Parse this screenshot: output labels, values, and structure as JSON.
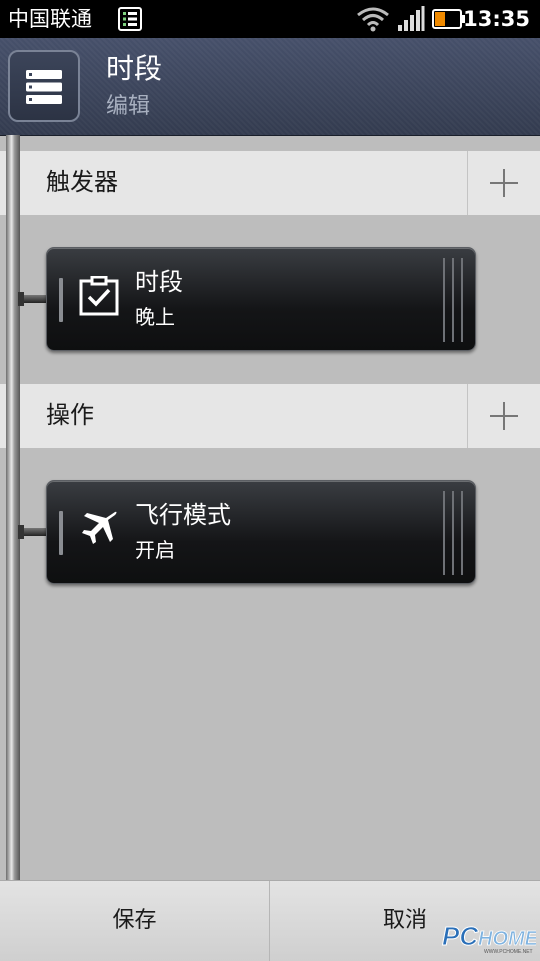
{
  "status_bar": {
    "carrier": "中国联通",
    "time": "13:35",
    "icons": [
      "sim-card-icon",
      "wifi-icon",
      "signal-icon",
      "battery-icon"
    ]
  },
  "header": {
    "title": "时段",
    "subtitle": "编辑",
    "icon": "server-list-icon"
  },
  "trigger_section": {
    "label": "触发器",
    "add_icon": "plus-icon",
    "card": {
      "icon": "checkbox-icon",
      "title": "时段",
      "value": "晚上"
    }
  },
  "action_section": {
    "label": "操作",
    "add_icon": "plus-icon",
    "card": {
      "icon": "airplane-icon",
      "title": "飞行模式",
      "value": "开启"
    }
  },
  "bottom_bar": {
    "save_label": "保存",
    "cancel_label": "取消"
  },
  "watermark": {
    "text": "PCHOME",
    "sub": "WWW.PCHOME.NET"
  },
  "colors": {
    "header_bg": "#3a4358",
    "page_bg": "#bdbdbd",
    "section_bg": "#e6e6e6",
    "card_bg": "#141517",
    "battery_fill": "#f08a00"
  }
}
